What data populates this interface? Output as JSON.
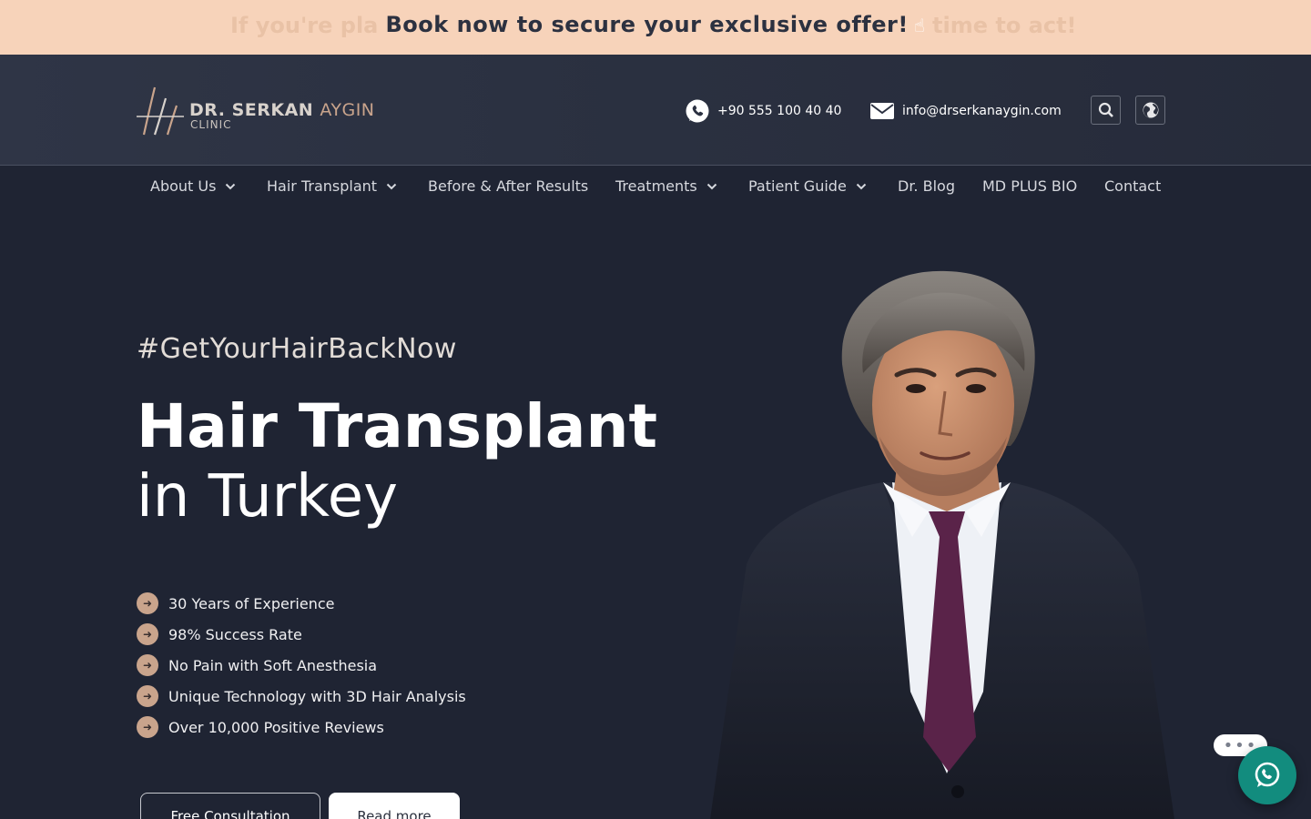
{
  "promo": {
    "ghost_left": "If you're pla",
    "text": "Book now to secure your exclusive offer!",
    "hand_icon": "pointing-hand-icon",
    "ghost_right": "time to act!"
  },
  "header": {
    "logo_name_a": "DR. SERKAN",
    "logo_name_b": "AYGIN",
    "logo_sub": "CLINIC",
    "phone": "+90 555 100 40 40",
    "email": "info@drserkanaygin.com",
    "search_icon": "search-icon",
    "language_icon": "globe-icon"
  },
  "nav": {
    "items": [
      {
        "label": "About Us",
        "dropdown": true
      },
      {
        "label": "Hair Transplant",
        "dropdown": true
      },
      {
        "label": "Before & After Results",
        "dropdown": false
      },
      {
        "label": "Treatments",
        "dropdown": true
      },
      {
        "label": "Patient Guide",
        "dropdown": true
      },
      {
        "label": "Dr. Blog",
        "dropdown": false
      },
      {
        "label": "MD PLUS BIO",
        "dropdown": false
      },
      {
        "label": "Contact",
        "dropdown": false
      }
    ]
  },
  "hero": {
    "tagline": "#GetYourHairBackNow",
    "title_line1": "Hair Transplant",
    "title_line2": "in Turkey",
    "features": [
      "30 Years of Experience",
      "98% Success Rate",
      "No Pain with Soft Anesthesia",
      "Unique Technology with 3D Hair Analysis",
      "Over 10,000 Positive Reviews"
    ],
    "btn_consult": "Free Consultation",
    "btn_more": "Read more"
  },
  "chat": {
    "bubble": "•••",
    "whatsapp_icon": "whatsapp-icon"
  },
  "colors": {
    "background": "#1f2433",
    "promo_bg": "#f7d3ba",
    "accent_gold": "#c9a48c",
    "whatsapp": "#128c7e"
  }
}
